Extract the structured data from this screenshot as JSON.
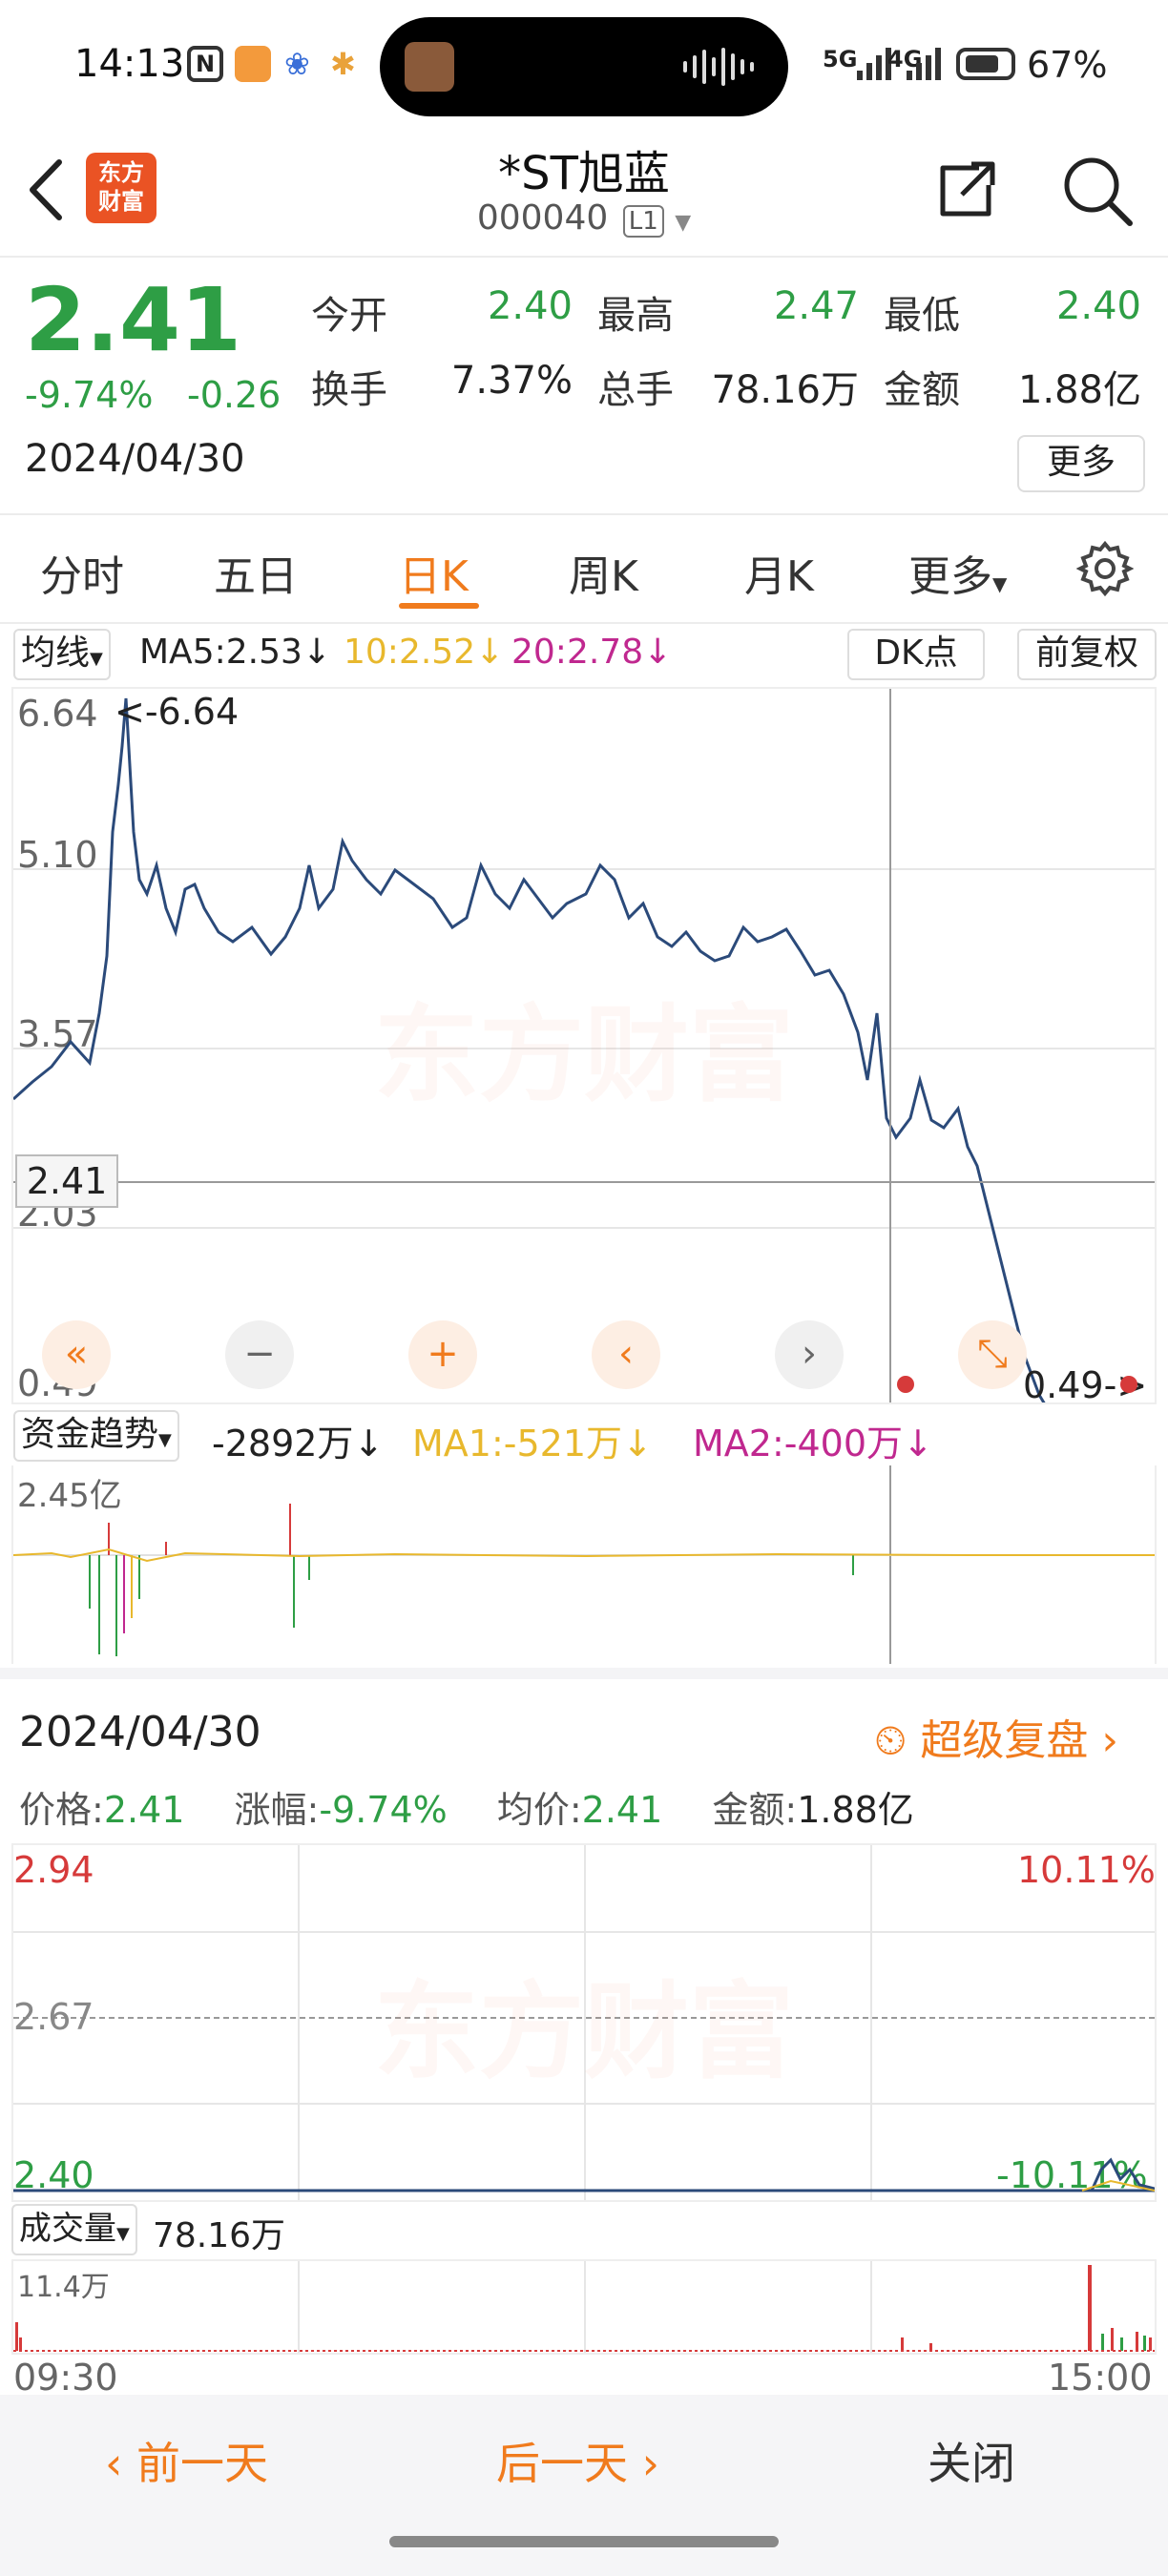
{
  "status": {
    "time": "14:13",
    "network1": "5G",
    "network2": "4G",
    "battery": "67%"
  },
  "header": {
    "title": "*ST旭蓝",
    "code": "000040",
    "level": "L1",
    "logo_line1": "东方",
    "logo_line2": "财富"
  },
  "quote": {
    "price": "2.41",
    "change_pct": "-9.74%",
    "change": "-0.26",
    "date": "2024/04/30",
    "open_label": "今开",
    "open": "2.40",
    "high_label": "最高",
    "high": "2.47",
    "low_label": "最低",
    "low": "2.40",
    "turnover_label": "换手",
    "turnover": "7.37%",
    "volume_label": "总手",
    "volume": "78.16万",
    "amount_label": "金额",
    "amount": "1.88亿",
    "more_label": "更多"
  },
  "tabs": [
    "分时",
    "五日",
    "日K",
    "周K",
    "月K",
    "更多"
  ],
  "active_tab": "日K",
  "kline": {
    "ma_selector": "均线",
    "ma5": "MA5:2.53",
    "ma10": "10:2.52",
    "ma20": "20:2.78",
    "dk_label": "DK点",
    "adjust_label": "前复权",
    "y_labels": [
      "6.64",
      "5.10",
      "3.57",
      "2.03",
      "0.49"
    ],
    "max_marker": "<-6.64",
    "min_marker": "0.49->",
    "crosshair_price": "2.41"
  },
  "fund": {
    "selector": "资金趋势",
    "value": "-2892万",
    "ma1": "MA1:-521万",
    "ma2": "MA2:-400万",
    "scale": "2.45亿"
  },
  "detail": {
    "date": "2024/04/30",
    "replay_label": "超级复盘",
    "price_label": "价格:",
    "price": "2.41",
    "change_label": "涨幅:",
    "change": "-9.74%",
    "avg_label": "均价:",
    "avg": "2.41",
    "amount_label": "金额:",
    "amount": "1.88亿",
    "y_top": "2.94",
    "y_mid": "2.67",
    "y_bot": "2.40",
    "pct_top": "10.11%",
    "pct_bot": "-10.11%",
    "vol_selector": "成交量",
    "vol_value": "78.16万",
    "vol_scale": "11.4万",
    "time_start": "09:30",
    "time_end": "15:00"
  },
  "bottom": {
    "prev": "前一天",
    "next": "后一天",
    "close": "关闭"
  },
  "colors": {
    "brand": "#ea5324",
    "up": "#d63a3a",
    "down": "#2e9e45",
    "accent": "#f07b1d",
    "ma10": "#e8b82d",
    "ma20": "#c0288f",
    "line": "#2b4a7a"
  }
}
